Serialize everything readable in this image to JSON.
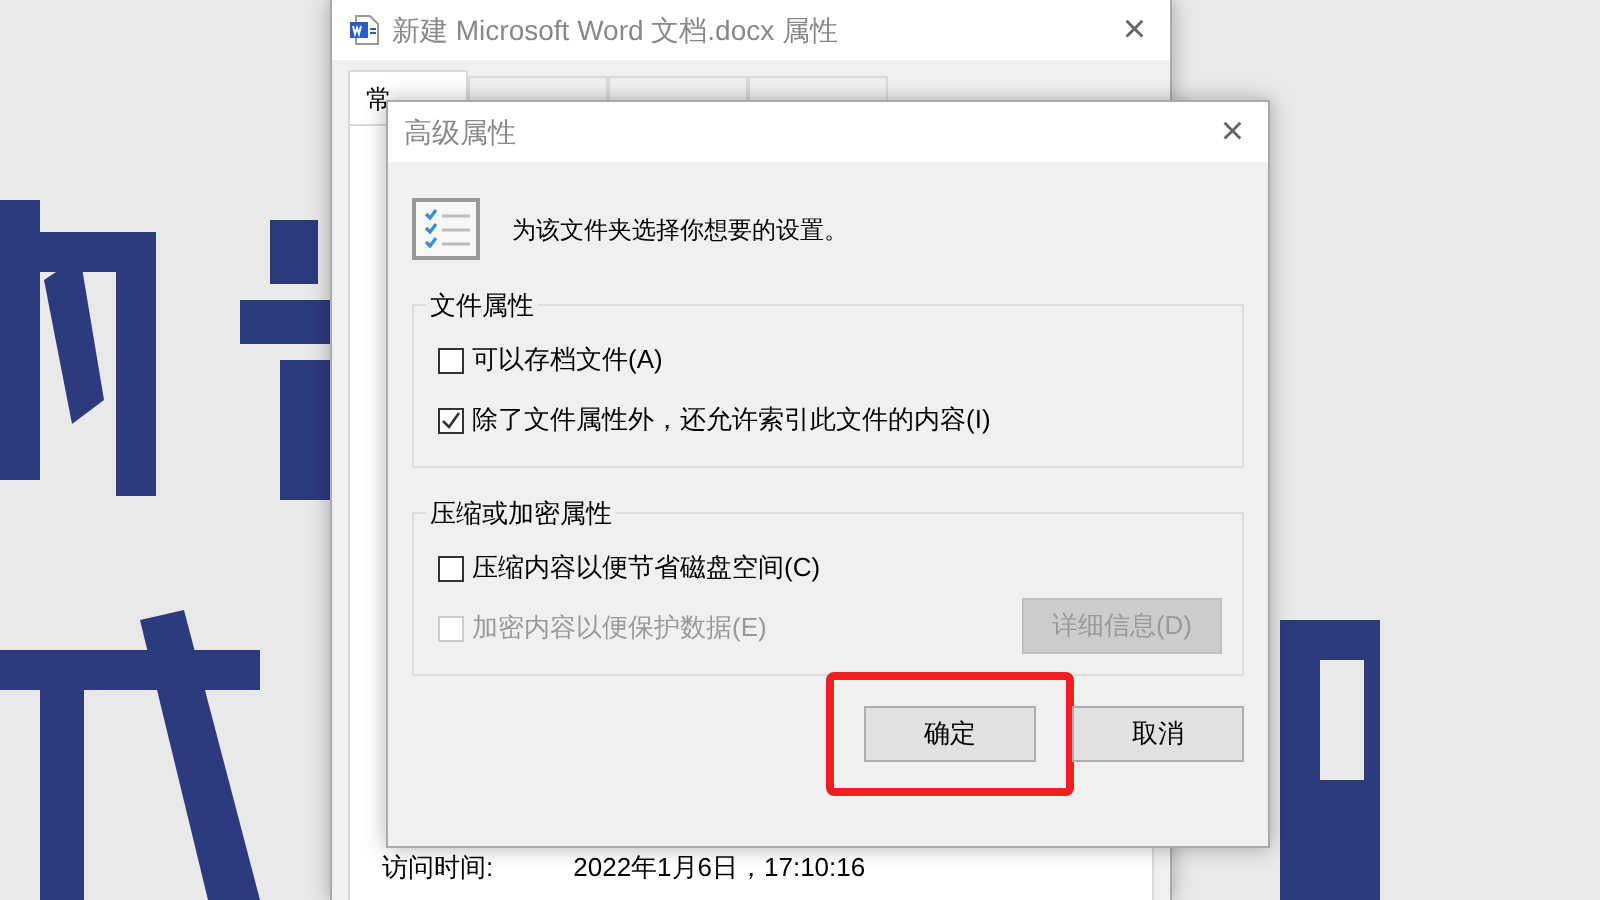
{
  "properties_window": {
    "title": "新建 Microsoft Word 文档.docx 属性",
    "close": "×",
    "tabs": [
      {
        "label": "常",
        "selected": true
      },
      {
        "selected": false
      },
      {
        "selected": false
      },
      {
        "selected": false
      }
    ],
    "fields": [
      {
        "label": "访问时间:",
        "value": "2022年1月6日，17:10:16"
      }
    ]
  },
  "dialog": {
    "title": "高级属性",
    "close": "×",
    "prompt": "为该文件夹选择你想要的设置。",
    "groups": [
      {
        "title": "文件属性",
        "options": [
          {
            "label": "可以存档文件(A)",
            "checked": false,
            "disabled": false
          },
          {
            "label": "除了文件属性外，还允许索引此文件的内容(I)",
            "checked": true,
            "disabled": false
          }
        ]
      },
      {
        "title": "压缩或加密属性",
        "options": [
          {
            "label": "压缩内容以便节省磁盘空间(C)",
            "checked": false,
            "disabled": false
          },
          {
            "label": "加密内容以便保护数据(E)",
            "checked": false,
            "disabled": true
          }
        ],
        "button": {
          "label": "详细信息(D)",
          "disabled": true
        }
      }
    ],
    "buttons": [
      {
        "label": "确定",
        "highlighted": true
      },
      {
        "label": "取消",
        "highlighted": false
      }
    ]
  }
}
